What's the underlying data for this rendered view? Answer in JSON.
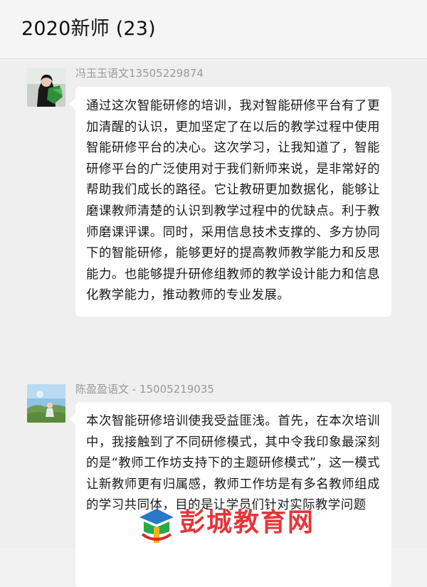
{
  "header": {
    "title": "2020新师 (23)"
  },
  "messages": [
    {
      "sender": "冯玉玉语文13505229874",
      "text": "通过这次智能研修的培训，我对智能研修平台有了更加清醒的认识，更加坚定了在以后的教学过程中使用智能研修平台的决心。这次学习，让我知道了，智能研修平台的广泛使用对于我们新师来说，是非常好的帮助我们成长的路径。它让教研更加数据化，能够让磨课教师清楚的认识到教学过程中的优缺点。利于教师磨课评课。同时，采用信息技术支撑的、多方协同下的智能研修，能够更好的提高教师教学能力和反思能力。也能够提升研修组教师的教学设计能力和信息化教学能力，推动教师的专业发展。"
    },
    {
      "sender": "陈盈盈语文 - 15005219035",
      "text": "本次智能研修培训使我受益匪浅。首先，在本次培训中，我接触到了不同研修模式，其中令我印象最深刻的是“教师工作坊支持下的主题研修模式”，这一模式让新教师更有归属感，教师工作坊是有多名教师组成的学习共同体，目的是让学员们针对实际教学问题"
    }
  ],
  "watermark": {
    "text": "彭城教育网"
  }
}
